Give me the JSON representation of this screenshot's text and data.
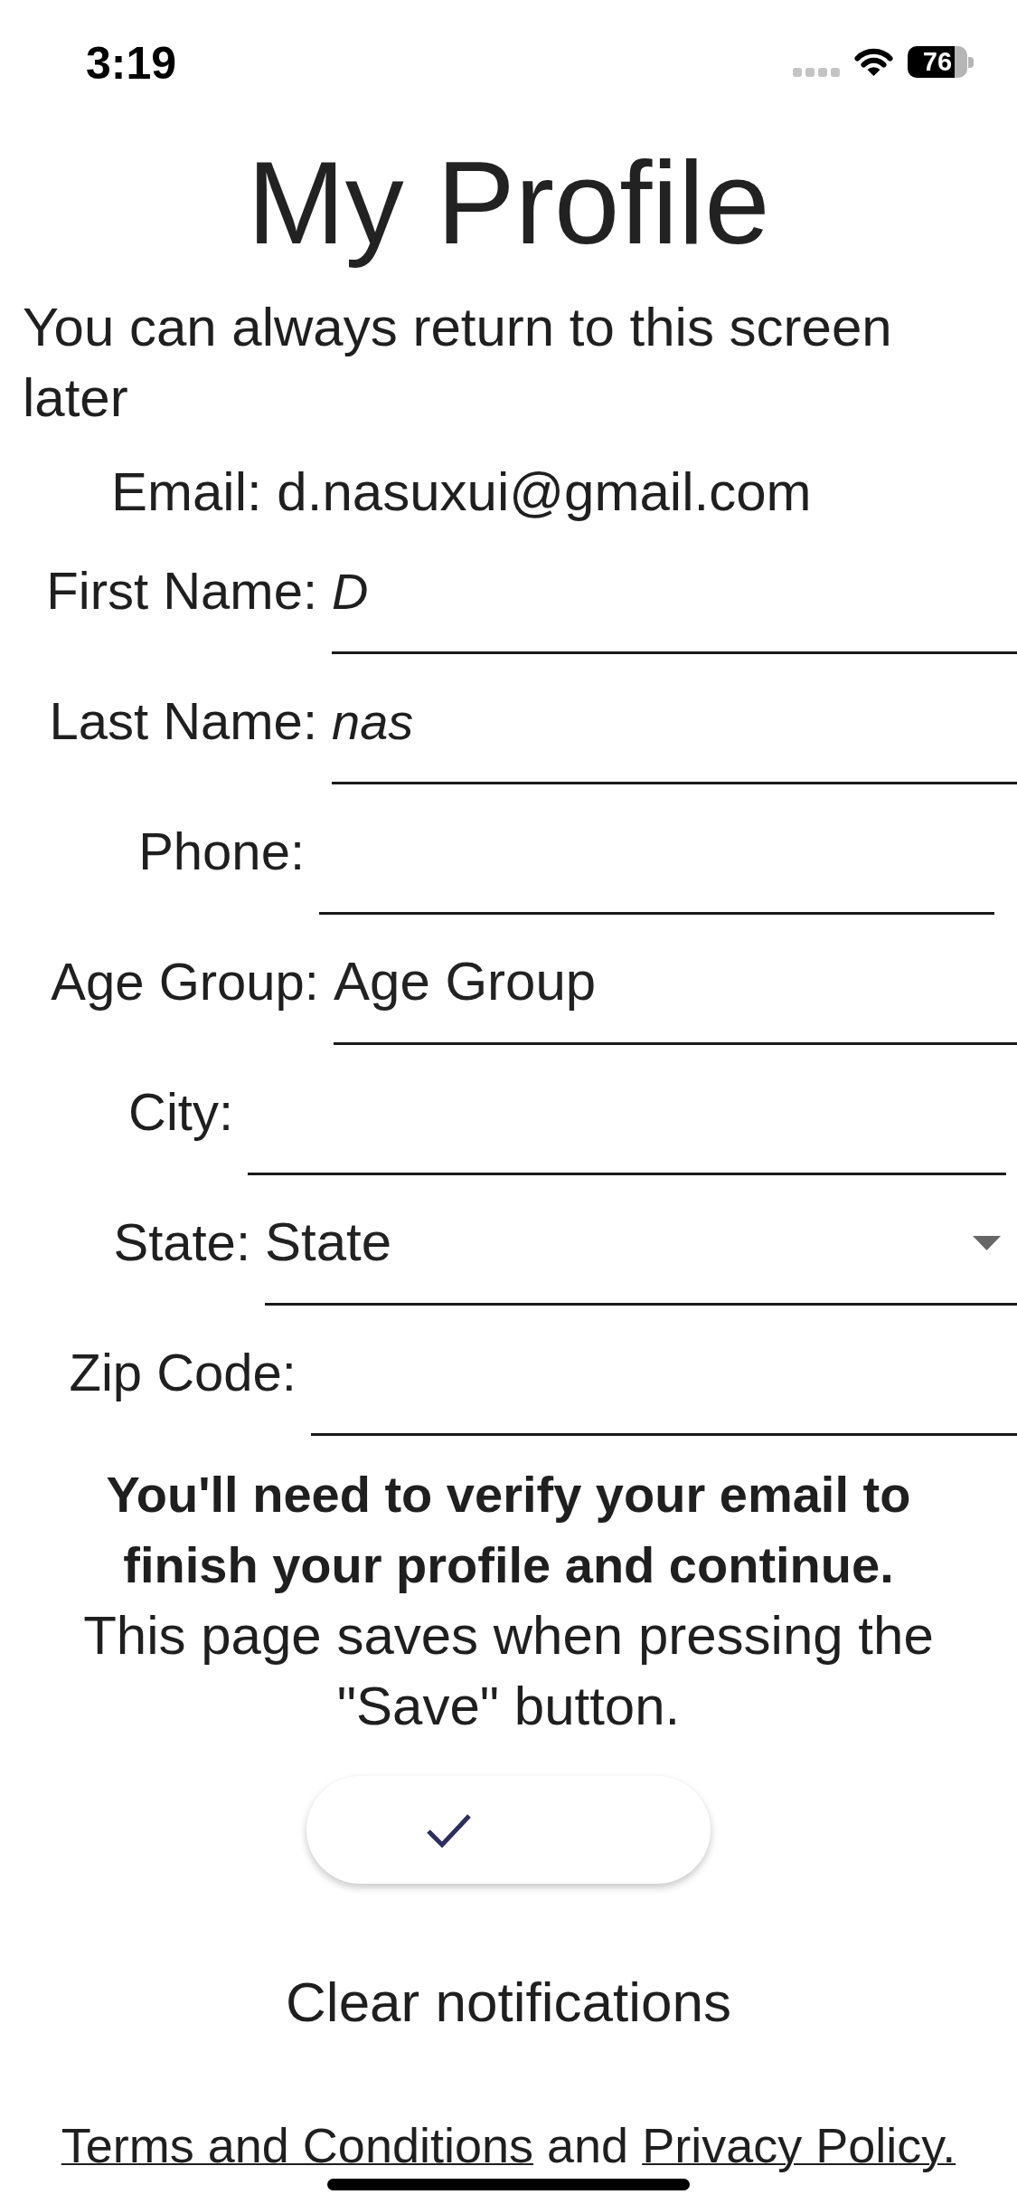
{
  "status_bar": {
    "time": "3:19",
    "battery": "76"
  },
  "title": "My Profile",
  "subtitle": "You can always return to this screen later",
  "email": "Email: d.nasuxui@gmail.com",
  "fields": [
    {
      "label": "First Name:",
      "kind": "text",
      "value": "D"
    },
    {
      "label": "Last Name:",
      "kind": "text",
      "value": "nas"
    },
    {
      "label": "Phone:",
      "kind": "text"
    },
    {
      "label": "Age Group:",
      "kind": "picker",
      "placeholder": "Age Group"
    },
    {
      "label": "City:",
      "kind": "text"
    },
    {
      "label": "State:",
      "kind": "dropdown",
      "placeholder": "State"
    },
    {
      "label": "Zip Code:",
      "kind": "text"
    }
  ],
  "notice": "You'll need to verify your email to finish your profile and continue.",
  "save_hint": "This page saves when pressing the \"Save\" button.",
  "clear_button": "Clear notifications",
  "legal": [
    {
      "kind": "link",
      "text": "Terms and Conditions"
    },
    {
      "kind": "text",
      "text": "and"
    },
    {
      "kind": "link",
      "text": "Privacy Policy."
    }
  ]
}
